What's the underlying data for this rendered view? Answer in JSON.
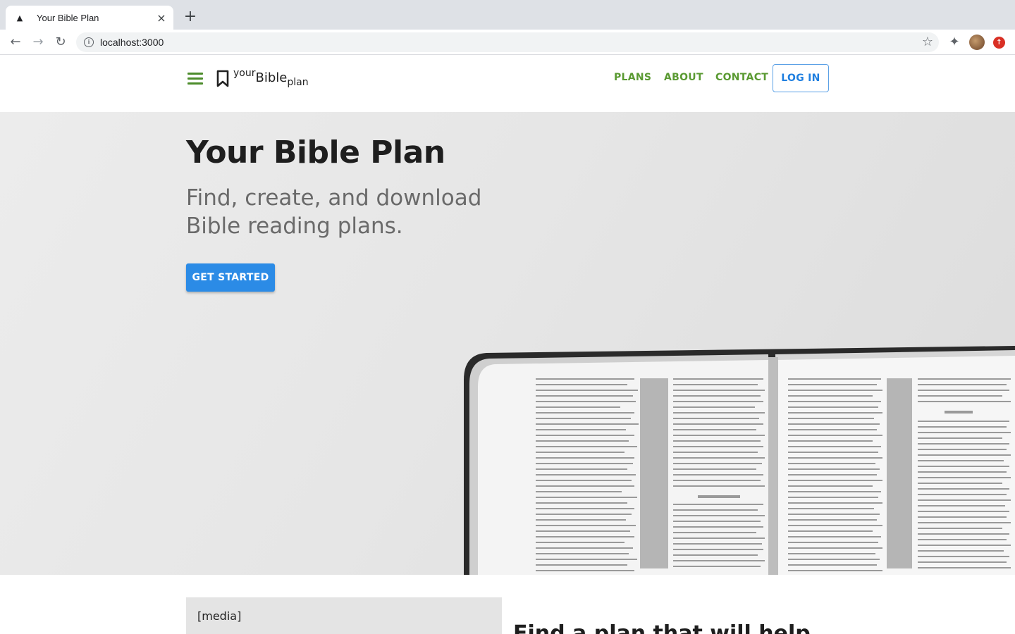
{
  "browser": {
    "tab_title": "Your Bible Plan",
    "tab_favicon": "triangle-icon",
    "url": "localhost:3000",
    "new_tab_label": "+",
    "close_label": "×"
  },
  "header": {
    "logo": {
      "your": "your",
      "bible": "Bible",
      "plan": "plan"
    },
    "nav": [
      {
        "label": "PLANS"
      },
      {
        "label": "ABOUT"
      },
      {
        "label": "CONTACT"
      }
    ],
    "login_label": "LOG IN"
  },
  "hero": {
    "title": "Your Bible Plan",
    "subtitle": "Find, create, and download Bible reading plans.",
    "cta_label": "GET STARTED"
  },
  "section2": {
    "media_label": "[media]",
    "heading": "Find a plan that will help"
  },
  "colors": {
    "nav_green": "#5a9a32",
    "login_blue": "#1f7fe0",
    "cta_blue": "#2b8be6",
    "hero_bg": "#e6e6e6"
  }
}
